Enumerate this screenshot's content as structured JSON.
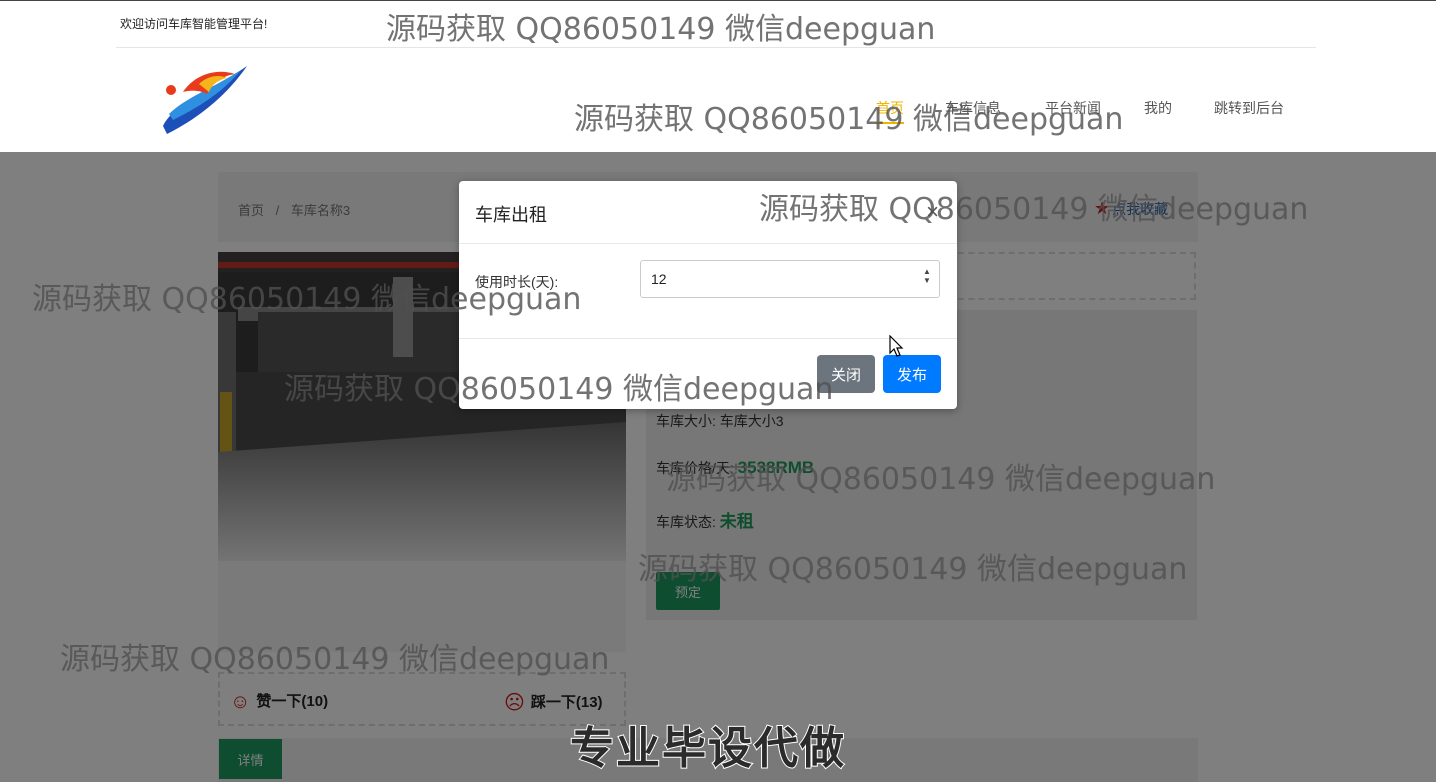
{
  "header": {
    "welcome": "欢迎访问车库智能管理平台!",
    "nav": [
      {
        "label": "首页",
        "active": true
      },
      {
        "label": "车库信息"
      },
      {
        "label": "平台新闻"
      },
      {
        "label": "我的"
      },
      {
        "label": "跳转到后台"
      }
    ]
  },
  "breadcrumb": {
    "home": "首页",
    "sep": "/",
    "current": "车库名称3"
  },
  "favorite": {
    "label": "点我收藏"
  },
  "garage": {
    "size_label": "车库大小:",
    "size_value": "车库大小3",
    "price_label": "车库价格/天:",
    "price_value": "3538RMB",
    "status_label": "车库状态:",
    "status_value": "未租",
    "reserve_button": "预定"
  },
  "reactions": {
    "like": "赞一下(10)",
    "dislike": "踩一下(13)"
  },
  "detail_tab": "详情",
  "modal": {
    "title": "车库出租",
    "field_label": "使用时长(天):",
    "field_value": "12",
    "close_button": "关闭",
    "publish_button": "发布"
  },
  "watermark": "源码获取 QQ86050149 微信deepguan",
  "banner": "专业毕设代做",
  "colors": {
    "accent_nav": "#f0b400",
    "primary": "#007bff",
    "secondary": "#6c757d",
    "success": "#1f9a63"
  }
}
